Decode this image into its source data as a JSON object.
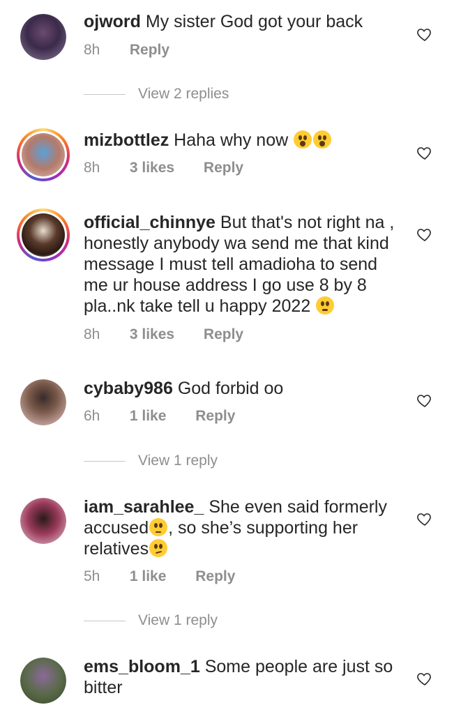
{
  "comments": [
    {
      "username": "ojword",
      "text": "My sister God got your back",
      "time": "8h",
      "likes": "",
      "reply_label": "Reply",
      "view_replies": "View 2 replies"
    },
    {
      "username": "mizbottlez",
      "text": "Haha  why now",
      "time": "8h",
      "likes": "3 likes",
      "reply_label": "Reply"
    },
    {
      "username": "official_chinnye",
      "text": "But that's not right na , honestly anybody wa send me that kind message I must tell amadioha to send me ur house address I go use 8 by 8 pla..nk take tell u happy 2022",
      "time": "8h",
      "likes": "3 likes",
      "reply_label": "Reply"
    },
    {
      "username": "cybaby986",
      "text": "God forbid oo",
      "time": "6h",
      "likes": "1 like",
      "reply_label": "Reply",
      "view_replies": "View 1 reply"
    },
    {
      "username": "iam_sarahlee_",
      "text": "She even said formerly accused",
      "text2": ", so she’s supporting her relatives",
      "time": "5h",
      "likes": "1 like",
      "reply_label": "Reply",
      "view_replies": "View 1 reply"
    },
    {
      "username": "ems_bloom_1",
      "text": "Some people are just so bitter"
    }
  ],
  "colors": {
    "text": "#262626",
    "meta": "#8e8e8e",
    "story_ring": [
      "#feda75",
      "#fa7e1e",
      "#d62976",
      "#962fbf",
      "#4f5bd5"
    ]
  },
  "icons": {
    "like": "heart-outline-icon",
    "emoji_surprised": "astonished-face-emoji",
    "emoji_flushed": "flushed-face-emoji",
    "emoji_eye_roll": "face-with-rolling-eyes-emoji",
    "emoji_smirk": "smirking-face-emoji"
  }
}
